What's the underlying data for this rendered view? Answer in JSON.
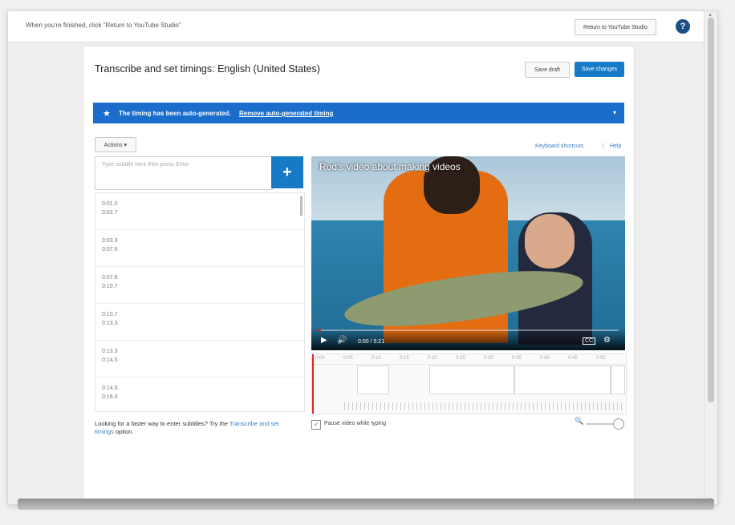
{
  "topbar": {
    "instruction": "When you're finished, click \"Return to YouTube Studio\"",
    "return_label": "Return to YouTube Studio",
    "help_glyph": "?"
  },
  "editor": {
    "title": "Transcribe and set timings: English (United States)",
    "save_draft_label": "Save draft",
    "save_changes_label": "Save changes"
  },
  "banner": {
    "star": "★",
    "message": "The timing has been auto-generated.",
    "link": "Remove auto-generated timing",
    "chevron": "▾",
    "color": "#1a6dcb"
  },
  "toolbar": {
    "actions_label": "Actions ▾",
    "keyboard_shortcuts": "Keyboard shortcuts",
    "separator": "|",
    "help": "Help"
  },
  "subtitle_input": {
    "placeholder": "Type subtitle here then press Enter",
    "add_glyph": "+"
  },
  "captions": [
    {
      "start": "0:01.0",
      "end": "0:02.7"
    },
    {
      "start": "0:03.3",
      "end": "0:07.6"
    },
    {
      "start": "0:07.6",
      "end": "0:10.7"
    },
    {
      "start": "0:10.7",
      "end": "0:13.3"
    },
    {
      "start": "0:13.3",
      "end": "0:14.5"
    },
    {
      "start": "0:14.5",
      "end": "0:16.0"
    }
  ],
  "hint": {
    "prefix": "Looking for a faster way to enter subtitles? Try the",
    "link": "Transcribe and set timings",
    "suffix": "option."
  },
  "video": {
    "title": "Rod's video about making videos",
    "play_glyph": "▶",
    "volume_glyph": "🔊",
    "time": "0:00 / 5:21",
    "cc_glyph": "CC",
    "settings_glyph": "⚙",
    "progress_fraction": 0.01
  },
  "timeline": {
    "ticks": [
      "0:00",
      "0:05",
      "0:10",
      "0:15",
      "0:20",
      "0:25",
      "0:30",
      "0:35",
      "0:40",
      "0:45",
      "0:50"
    ]
  },
  "options": {
    "pause_check": "✓",
    "pause_label": "Pause video while typing",
    "zoom_glyph": "🔍"
  }
}
